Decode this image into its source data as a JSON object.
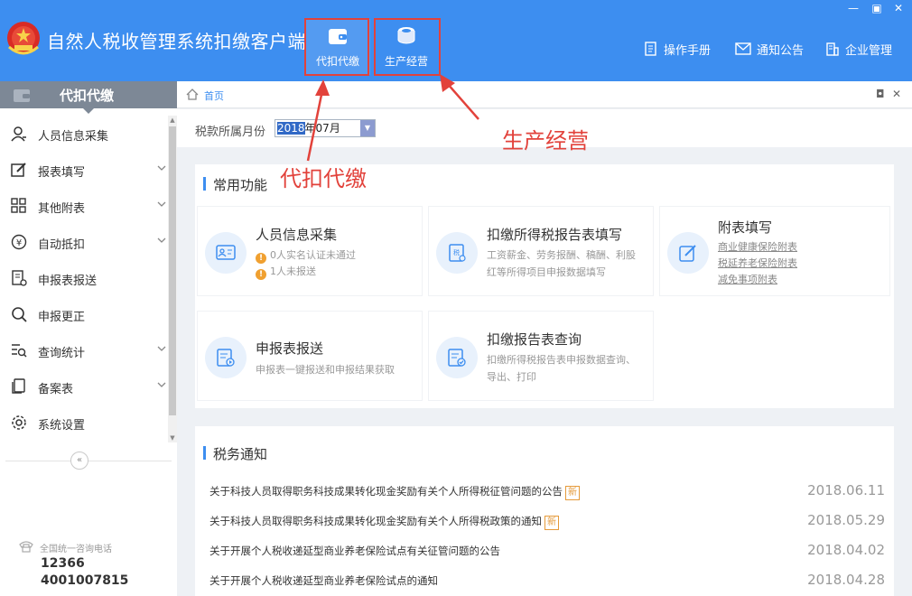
{
  "app": {
    "title": "自然人税收管理系统扣缴客户端"
  },
  "module_tabs": [
    {
      "label": "代扣代缴",
      "icon": "wallet-icon"
    },
    {
      "label": "生产经营",
      "icon": "coins-icon"
    }
  ],
  "top_links": [
    {
      "label": "操作手册",
      "icon": "manual-icon"
    },
    {
      "label": "通知公告",
      "icon": "mail-icon"
    },
    {
      "label": "企业管理",
      "icon": "building-icon"
    }
  ],
  "sidebar": {
    "header": "代扣代缴",
    "items": [
      {
        "label": "人员信息采集",
        "icon": "person-icon"
      },
      {
        "label": "报表填写",
        "icon": "edit-icon"
      },
      {
        "label": "其他附表",
        "icon": "grid-icon"
      },
      {
        "label": "自动抵扣",
        "icon": "yen-circle-icon"
      },
      {
        "label": "申报表报送",
        "icon": "report-send-icon"
      },
      {
        "label": "申报更正",
        "icon": "search-icon"
      },
      {
        "label": "查询统计",
        "icon": "list-search-icon"
      },
      {
        "label": "备案表",
        "icon": "files-icon"
      },
      {
        "label": "系统设置",
        "icon": "gear-icon"
      }
    ],
    "hotline_label": "全国统一咨询电话",
    "hotline_numbers": [
      "12366",
      "4001007815"
    ]
  },
  "breadcrumb": {
    "home": "首页"
  },
  "period": {
    "label": "税款所属月份",
    "year": "2018",
    "rest": "年07月"
  },
  "common_functions": {
    "title": "常用功能",
    "cards": [
      {
        "title": "人员信息采集",
        "lines": [
          "0人实名认证未通过",
          "1人未报送"
        ]
      },
      {
        "title": "扣缴所得税报告表填写",
        "lines": [
          "工资薪金、劳务报酬、稿酬、利股",
          "红等所得项目申报数据填写"
        ]
      },
      {
        "title": "附表填写",
        "links": [
          "商业健康保险附表",
          "税延养老保险附表",
          "减免事项附表"
        ]
      },
      {
        "title": "申报表报送",
        "lines": [
          "申报表一键报送和申报结果获取"
        ]
      },
      {
        "title": "扣缴报告表查询",
        "lines": [
          "扣缴所得税报告表申报数据查询、",
          "导出、打印"
        ]
      }
    ]
  },
  "tax_notices": {
    "title": "税务通知",
    "new_label": "新",
    "items": [
      {
        "text": "关于科技人员取得职务科技成果转化现金奖励有关个人所得税征管问题的公告",
        "date": "2018.06.11",
        "is_new": true
      },
      {
        "text": "关于科技人员取得职务科技成果转化现金奖励有关个人所得税政策的通知",
        "date": "2018.05.29",
        "is_new": true
      },
      {
        "text": "关于开展个人税收递延型商业养老保险试点有关征管问题的公告",
        "date": "2018.04.02",
        "is_new": false
      },
      {
        "text": "关于开展个人税收递延型商业养老保险试点的通知",
        "date": "2018.04.28",
        "is_new": false
      }
    ]
  },
  "annotations": [
    "代扣代缴",
    "生产经营"
  ],
  "colors": {
    "header": "#3d8ef0",
    "accent_red": "#e2423b",
    "badge": "#e59a3a"
  }
}
